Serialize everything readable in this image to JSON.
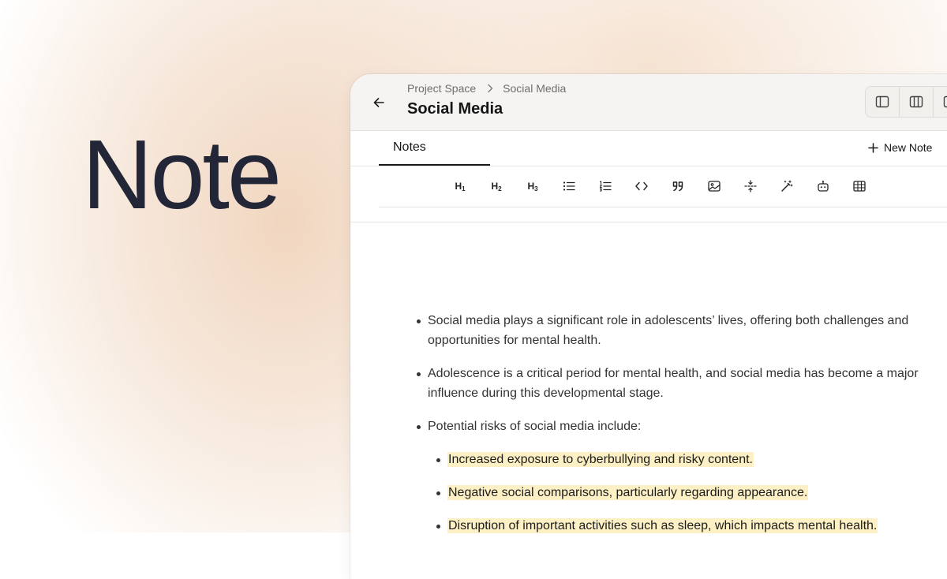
{
  "hero": {
    "word": "Note"
  },
  "header": {
    "breadcrumb": [
      "Project Space",
      "Social Media"
    ],
    "title": "Social Media"
  },
  "tabs": {
    "active": "Notes"
  },
  "actions": {
    "new_note": "New Note"
  },
  "toolbar": {
    "h1": "H",
    "h1_sub": "1",
    "h2": "H",
    "h2_sub": "2",
    "h3": "H",
    "h3_sub": "3"
  },
  "content": {
    "bullets": [
      "Social media plays a significant role in adolescents’ lives, offering both challenges and opportunities for mental health.",
      "Adolescence is a critical period for mental health, and social media has become a major influence during this developmental stage.",
      "Potential risks of social media include:"
    ],
    "sub_bullets": [
      "Increased exposure to cyberbullying and risky content.",
      "Negative social comparisons, particularly regarding appearance.",
      "Disruption of important activities such as sleep, which impacts mental health."
    ]
  },
  "colors": {
    "hero_text": "#232637",
    "highlight": "#fcf0c4",
    "titlebar_bg": "#f6f4f2",
    "backdrop_peach": "#f0d4bc"
  }
}
